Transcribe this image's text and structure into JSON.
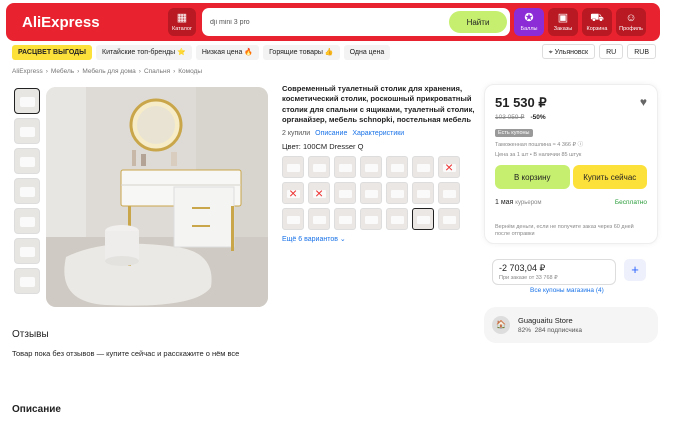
{
  "header": {
    "logo": "AliExpress",
    "catalog_label": "Каталог",
    "search_value": "dji mini 3 pro",
    "search_button": "Найти",
    "buttons": [
      {
        "label": "Баллы",
        "icon": "coins-icon"
      },
      {
        "label": "Заказы",
        "icon": "box-icon"
      },
      {
        "label": "Корзина",
        "icon": "cart-icon"
      },
      {
        "label": "Профиль",
        "icon": "smile-icon"
      }
    ]
  },
  "subnav": {
    "items": [
      "РАСЦВЕТ ВЫГОДЫ",
      "Китайские топ-бренды ⭐",
      "Низкая цена 🔥",
      "Горящие товары 👍",
      "Одна цена"
    ],
    "location": "Ульяновск",
    "lang": "RU",
    "currency": "RUB"
  },
  "breadcrumbs": [
    "AliExpress",
    "›",
    "Мебель",
    "›",
    "Мебель для дома",
    "›",
    "Спальня",
    "›",
    "Комоды"
  ],
  "product": {
    "title": "Современный туалетный столик для хранения, косметический столик, роскошный прикроватный столик для спальни с ящиками, туалетный столик, органайзер, мебель schnopki, постельная мебель",
    "purchases": "2 купили",
    "link_description": "Описание",
    "link_specs": "Характеристики",
    "color_label": "Цвет: 100CM Dresser Q",
    "more_variants": "Ещё 6 вариантов"
  },
  "buy": {
    "price": "51 530 ₽",
    "old_price": "103 059 ₽",
    "discount": "-50%",
    "tag": "Есть купоны",
    "duty": "Таможенная пошлина ≈ 4 366 ₽",
    "unit_price": "Цена за 1 шт • В наличии 85 штук",
    "add_to_cart": "В корзину",
    "buy_now": "Купить сейчас",
    "delivery_date": "1 мая",
    "delivery_type": "курьером",
    "delivery_cost": "Бесплатно",
    "refund": "Вернём деньги, если не получите заказ через 60 дней после отправки",
    "coupon_value": "-2 703,04 ₽",
    "coupon_sub": "При заказе от 33 768 ₽",
    "more_coupons": "Все купоны магазина (4)",
    "plus": "+"
  },
  "store": {
    "avatar": "🏠",
    "name": "Guaguaitu Store",
    "rating": "82%",
    "subscribers": "284 подписчика"
  },
  "reviews": {
    "title": "Отзывы",
    "empty": "Товар пока без отзывов — купите сейчас и расскажите о нём все"
  },
  "description_title": "Описание",
  "colors": {
    "brand_red": "#e8232f",
    "green_btn": "#c6ef6f",
    "yellow_btn": "#fde13b",
    "link": "#1a73e8"
  }
}
